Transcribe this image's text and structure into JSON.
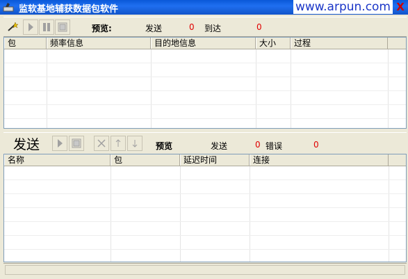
{
  "window": {
    "title": "监软基地辅获数据包软件",
    "watermark": "www.arpun.com",
    "close_glyph": "X"
  },
  "top_toolbar": {
    "preview_label": "预览:",
    "sent_label": "发送",
    "sent_count": "0",
    "arrived_label": "到达",
    "arrived_count": "0"
  },
  "top_table": {
    "columns": [
      "包",
      "频率信息",
      "目的地信息",
      "大小",
      "过程"
    ]
  },
  "bottom_toolbar": {
    "send_label": "发送",
    "preview_label": "预览",
    "sent_label": "发送",
    "sent_count": "0",
    "error_label": "错误",
    "error_count": "0"
  },
  "bottom_table": {
    "columns": [
      "名称",
      "包",
      "延迟时间",
      "连接"
    ]
  },
  "colors": {
    "title_blue": "#1f6ff0",
    "count_red": "#e00000",
    "watermark_blue": "#1b36c8"
  }
}
